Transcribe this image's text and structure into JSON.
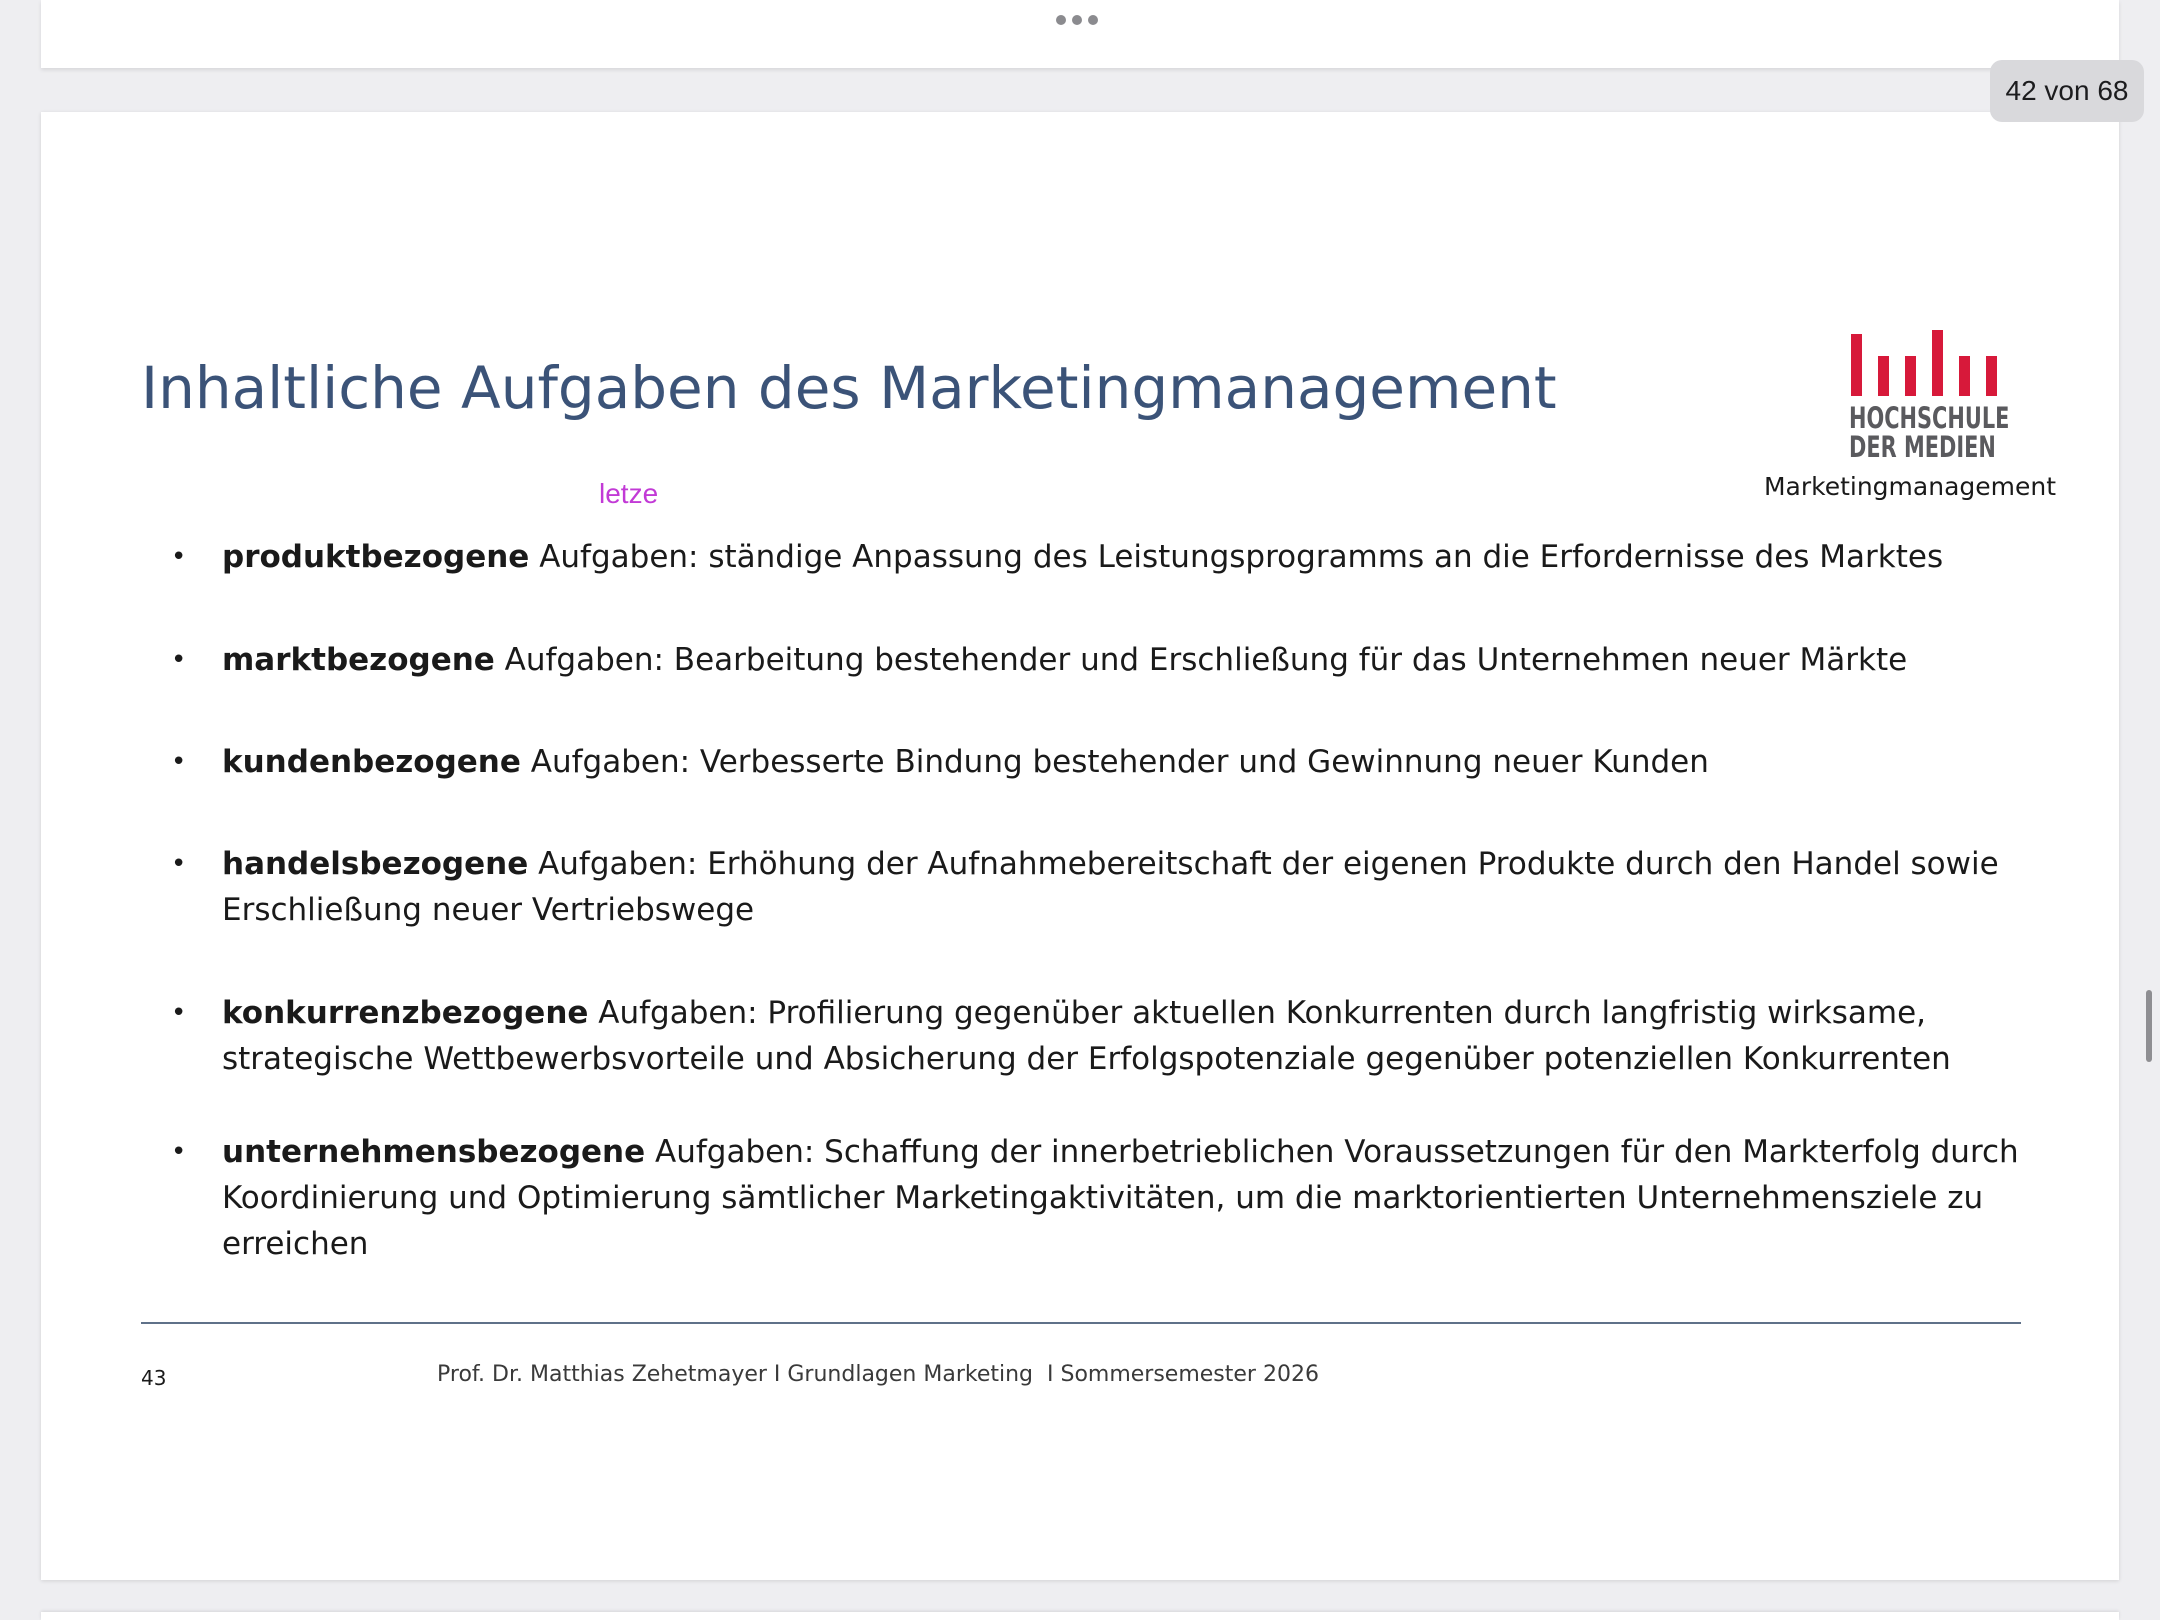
{
  "viewer": {
    "page_indicator": "42 von 68"
  },
  "slide": {
    "title": "Inhaltliche Aufgaben des Marketingmanagement",
    "annotation": "letze",
    "logo": {
      "line1": "HOCHSCHULE",
      "line2": "DER MEDIEN",
      "caption": "Marketingmanagement",
      "color": "#d7193a"
    },
    "bullets": [
      {
        "bold": "produktbezogene",
        "rest": " Aufgaben: ständige Anpassung des Leistungsprogramms an die Erfordernisse des Marktes"
      },
      {
        "bold": "marktbezogene",
        "rest": " Aufgaben: Bearbeitung bestehender und Erschließung für das Unternehmen neuer Märkte"
      },
      {
        "bold": "kundenbezogene",
        "rest": " Aufgaben: Verbesserte Bindung bestehender und Gewinnung neuer Kunden"
      },
      {
        "bold": "handelsbezogene",
        "rest": " Aufgaben: Erhöhung der Aufnahmebereitschaft der eigenen Produkte durch den Handel sowie Erschließung neuer Vertriebswege"
      },
      {
        "bold": "konkurrenzbezogene",
        "rest": " Aufgaben: Profilierung gegenüber aktuellen Konkurrenten durch langfristig wirksame, strategische Wettbewerbsvorteile und Absicherung der Erfolgspotenziale gegenüber potenziellen Konkurrenten"
      },
      {
        "bold": "unternehmensbezogene",
        "rest": " Aufgaben: Schaffung der innerbetrieblichen Voraussetzungen für den Markterfolg durch Koordinierung und Optimierung sämtlicher Marketingaktivitäten, um die marktorientierten Unternehmensziele zu erreichen"
      }
    ],
    "footer": {
      "page_number": "43",
      "text": "Prof. Dr. Matthias Zehetmayer I Grundlagen Marketing  I Sommersemester 2026"
    }
  }
}
